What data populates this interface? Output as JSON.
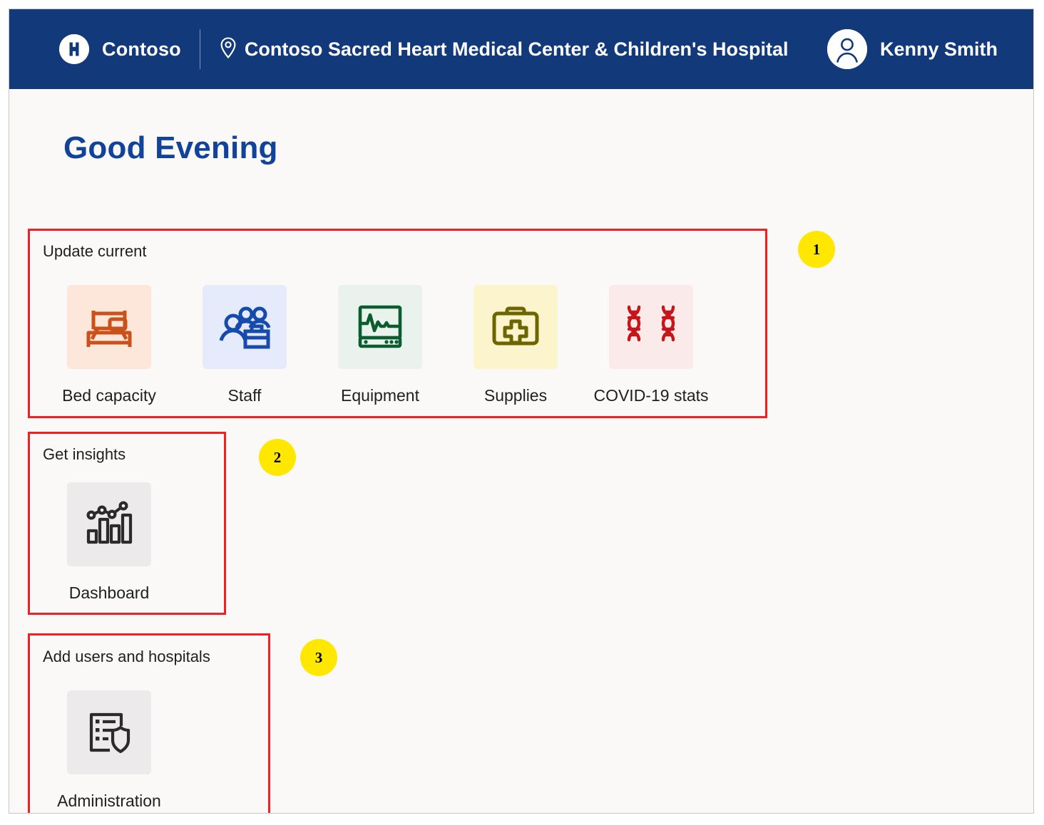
{
  "header": {
    "logo_icon": "hospital-h-logo-icon",
    "brand": "Contoso",
    "location_icon": "map-pin-icon",
    "facility": "Contoso Sacred Heart Medical Center & Children's Hospital",
    "avatar_icon": "user-avatar-icon",
    "user_name": "Kenny Smith",
    "background_color": "#123a7a"
  },
  "page": {
    "greeting": "Good Evening",
    "greeting_color": "#12439b",
    "background_color": "#faf9f7"
  },
  "groups": [
    {
      "title": "Update current",
      "badge": "1",
      "tiles": [
        {
          "label": "Bed capacity",
          "icon": "bed-icon",
          "icon_color": "#c8521a",
          "tile_color": "#fce7da"
        },
        {
          "label": "Staff",
          "icon": "staff-group-icon",
          "icon_color": "#164bad",
          "tile_color": "#e5ebfb"
        },
        {
          "label": "Equipment",
          "icon": "vitals-monitor-icon",
          "icon_color": "#0b5c2e",
          "tile_color": "#e9f2ec"
        },
        {
          "label": "Supplies",
          "icon": "first-aid-kit-icon",
          "icon_color": "#6d6500",
          "tile_color": "#fbf4cd"
        },
        {
          "label": "COVID-19 stats",
          "icon": "dna-helix-icon",
          "icon_color": "#c5161c",
          "tile_color": "#fbeaea"
        }
      ]
    },
    {
      "title": "Get insights",
      "badge": "2",
      "tiles": [
        {
          "label": "Dashboard",
          "icon": "bar-chart-trend-icon",
          "icon_color": "#2b2b2b",
          "tile_color": "#eceaea"
        }
      ]
    },
    {
      "title": "Add users and hospitals",
      "badge": "3",
      "tiles": [
        {
          "label": "Administration",
          "icon": "list-shield-icon",
          "icon_color": "#2b2b2b",
          "tile_color": "#eceaea"
        }
      ]
    }
  ],
  "annotation": {
    "outline_color": "#ee2223",
    "badge_color": "#ffe700",
    "badge_text_color": "#000000"
  }
}
